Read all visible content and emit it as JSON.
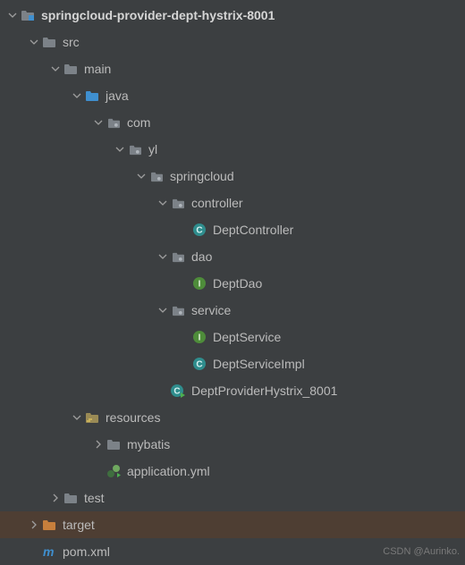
{
  "watermark": "CSDN @Aurinko.",
  "nodes": [
    {
      "depth": 0,
      "arrow": "down",
      "icon": "module-folder",
      "label": "springcloud-provider-dept-hystrix-8001",
      "bold": true
    },
    {
      "depth": 1,
      "arrow": "down",
      "icon": "folder",
      "label": "src"
    },
    {
      "depth": 2,
      "arrow": "down",
      "icon": "folder",
      "label": "main"
    },
    {
      "depth": 3,
      "arrow": "down",
      "icon": "source-folder",
      "label": "java"
    },
    {
      "depth": 4,
      "arrow": "down",
      "icon": "package",
      "label": "com"
    },
    {
      "depth": 5,
      "arrow": "down",
      "icon": "package",
      "label": "yl"
    },
    {
      "depth": 6,
      "arrow": "down",
      "icon": "package",
      "label": "springcloud"
    },
    {
      "depth": 7,
      "arrow": "down",
      "icon": "package",
      "label": "controller"
    },
    {
      "depth": 8,
      "arrow": "none",
      "icon": "class",
      "label": "DeptController"
    },
    {
      "depth": 7,
      "arrow": "down",
      "icon": "package",
      "label": "dao"
    },
    {
      "depth": 8,
      "arrow": "none",
      "icon": "interface",
      "label": "DeptDao"
    },
    {
      "depth": 7,
      "arrow": "down",
      "icon": "package",
      "label": "service"
    },
    {
      "depth": 8,
      "arrow": "none",
      "icon": "interface",
      "label": "DeptService"
    },
    {
      "depth": 8,
      "arrow": "none",
      "icon": "class",
      "label": "DeptServiceImpl"
    },
    {
      "depth": 7,
      "arrow": "none",
      "icon": "run-class",
      "label": "DeptProviderHystrix_8001"
    },
    {
      "depth": 3,
      "arrow": "down",
      "icon": "resources-folder",
      "label": "resources"
    },
    {
      "depth": 4,
      "arrow": "right",
      "icon": "folder",
      "label": "mybatis"
    },
    {
      "depth": 4,
      "arrow": "none",
      "icon": "yml-file",
      "label": "application.yml"
    },
    {
      "depth": 2,
      "arrow": "right",
      "icon": "folder",
      "label": "test"
    },
    {
      "depth": 1,
      "arrow": "right",
      "icon": "target-folder",
      "label": "target",
      "highlight": true
    },
    {
      "depth": 1,
      "arrow": "none",
      "icon": "maven-file",
      "label": "pom.xml"
    }
  ]
}
